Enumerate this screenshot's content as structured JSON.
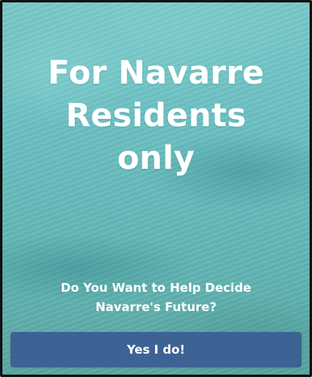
{
  "hero": {
    "headline_lines": [
      "For Navarre",
      "Residents",
      "only"
    ]
  },
  "prompt": {
    "question_lines": [
      "Do You Want to Help Decide",
      "Navarre's Future?"
    ]
  },
  "cta": {
    "label": "Yes I do!"
  },
  "colors": {
    "background_water": "#6fc2c4",
    "button": "#3d6294",
    "text": "#ffffff",
    "frame_border": "#111111"
  }
}
